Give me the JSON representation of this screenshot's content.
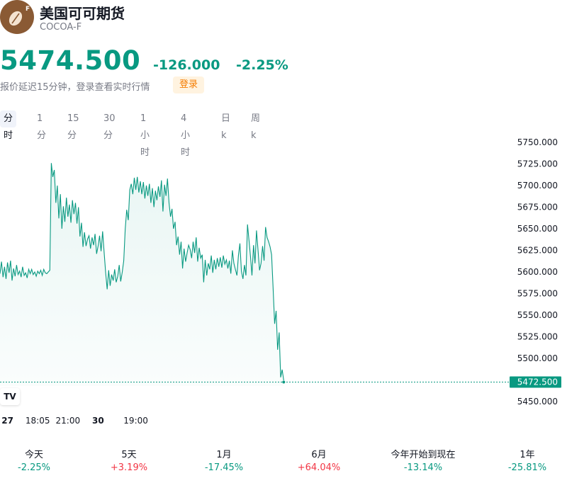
{
  "header": {
    "title": "美国可可期货",
    "ticker": "COCOA-F",
    "logo_icon": "cocoa-bean-icon",
    "logo_badge": "F"
  },
  "quote": {
    "price": "5474.500",
    "change": "-126.000",
    "change_pct": "-2.25%",
    "delay_note": "报价延迟15分钟，登录查看实时行情",
    "login_label": "登录"
  },
  "tabs": [
    {
      "label": "分时",
      "active": true
    },
    {
      "label": "1分",
      "active": false
    },
    {
      "label": "15分",
      "active": false
    },
    {
      "label": "30分",
      "active": false
    },
    {
      "label": "1小时",
      "active": false
    },
    {
      "label": "4小时",
      "active": false
    },
    {
      "label": "日k",
      "active": false
    },
    {
      "label": "周k",
      "active": false
    }
  ],
  "tv_logo": "TV",
  "colors": {
    "down": "#089981",
    "up": "#f23645",
    "line": "#089981",
    "login_bg": "#fff3e0",
    "login_text": "#f57c00"
  },
  "chart_data": {
    "type": "area",
    "title": "",
    "xlabel": "",
    "ylabel": "",
    "ylim": [
      5437.5,
      5762.5
    ],
    "y_ticks": [
      5750,
      5725,
      5700,
      5675,
      5650,
      5625,
      5600,
      5575,
      5550,
      5525,
      5500,
      5450
    ],
    "y_tick_labels": [
      "5750.000",
      "5725.000",
      "5700.000",
      "5675.000",
      "5650.000",
      "5625.000",
      "5600.000",
      "5575.000",
      "5550.000",
      "5525.000",
      "5500.000",
      "5450.000"
    ],
    "x_ticks": [
      {
        "label": "27",
        "bold": true,
        "t": 5
      },
      {
        "label": "18:05",
        "bold": false,
        "t": 25
      },
      {
        "label": "21:00",
        "bold": false,
        "t": 45
      },
      {
        "label": "30",
        "bold": true,
        "t": 65
      },
      {
        "label": "19:00",
        "bold": false,
        "t": 90
      }
    ],
    "x_range": [
      0,
      186
    ],
    "current_price": 5472.5,
    "current_price_label": "5472.500",
    "series": [
      {
        "values": [
          5598,
          5612,
          5594,
          5606,
          5592,
          5611,
          5599,
          5613,
          5590,
          5604,
          5595,
          5608,
          5597,
          5601,
          5594,
          5606,
          5596,
          5599,
          5593,
          5603,
          5598,
          5603,
          5597,
          5600,
          5595,
          5601,
          5598,
          5602,
          5596,
          5603,
          5599,
          5598,
          5600,
          5602,
          5726,
          5710,
          5718,
          5680,
          5700,
          5662,
          5690,
          5650,
          5676,
          5658,
          5686,
          5664,
          5678,
          5657,
          5683,
          5667,
          5680,
          5656,
          5675,
          5641,
          5657,
          5629,
          5646,
          5630,
          5638,
          5642,
          5627,
          5640,
          5631,
          5644,
          5621,
          5630,
          5642,
          5624,
          5647,
          5623,
          5600,
          5580,
          5602,
          5584,
          5597,
          5590,
          5603,
          5588,
          5595,
          5608,
          5589,
          5600,
          5613,
          5650,
          5672,
          5660,
          5695,
          5702,
          5690,
          5709,
          5695,
          5710,
          5692,
          5705,
          5690,
          5704,
          5685,
          5700,
          5688,
          5702,
          5680,
          5697,
          5675,
          5694,
          5683,
          5699,
          5687,
          5706,
          5670,
          5701,
          5688,
          5708,
          5680,
          5664,
          5673,
          5650,
          5658,
          5631,
          5641,
          5620,
          5635,
          5604,
          5627,
          5612,
          5622,
          5631,
          5626,
          5616,
          5635,
          5622,
          5640,
          5612,
          5628,
          5616,
          5620,
          5588,
          5614,
          5596,
          5610,
          5603,
          5619,
          5599,
          5614,
          5603,
          5616,
          5606,
          5617,
          5605,
          5619,
          5609,
          5614,
          5604,
          5613,
          5598,
          5625,
          5610,
          5603,
          5596,
          5619,
          5633,
          5601,
          5592,
          5608,
          5596,
          5655,
          5637,
          5618,
          5596,
          5631,
          5610,
          5648,
          5625,
          5602,
          5610,
          5630,
          5613,
          5652,
          5640,
          5635,
          5629,
          5620,
          5580,
          5540,
          5555,
          5510,
          5530,
          5478,
          5487,
          5474.5
        ]
      }
    ]
  },
  "periods": [
    {
      "label": "今天",
      "value": "-2.25%",
      "direction": "down"
    },
    {
      "label": "5天",
      "value": "+3.19%",
      "direction": "up"
    },
    {
      "label": "1月",
      "value": "-17.45%",
      "direction": "down"
    },
    {
      "label": "6月",
      "value": "+64.04%",
      "direction": "up"
    },
    {
      "label": "今年开始到现在",
      "value": "-13.14%",
      "direction": "down"
    },
    {
      "label": "1年",
      "value": "-25.81%",
      "direction": "down"
    }
  ]
}
